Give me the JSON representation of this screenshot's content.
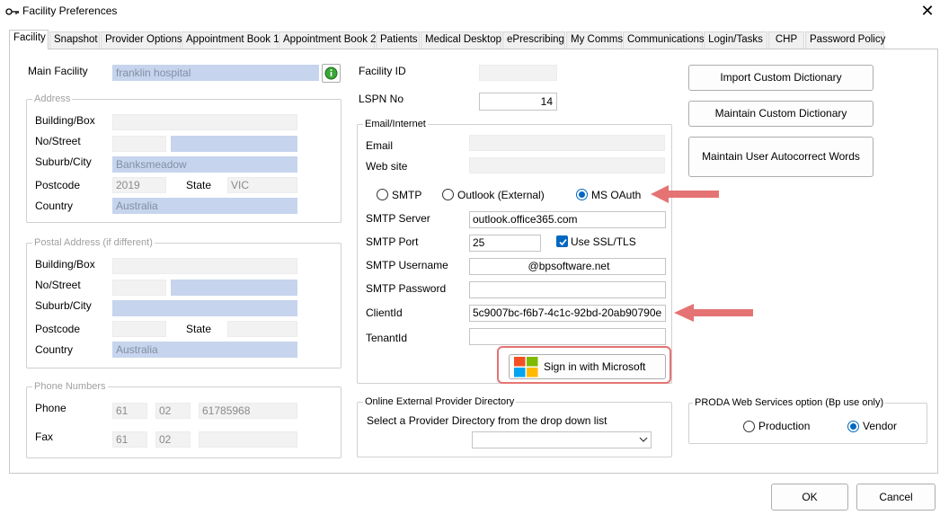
{
  "window": {
    "title": "Facility Preferences"
  },
  "tabs": [
    {
      "label": "Facility",
      "active": true
    },
    {
      "label": "Snapshot"
    },
    {
      "label": "Provider Options"
    },
    {
      "label": "Appointment Book 1"
    },
    {
      "label": "Appointment Book 2"
    },
    {
      "label": "Patients"
    },
    {
      "label": "Medical Desktop"
    },
    {
      "label": "ePrescribing"
    },
    {
      "label": "My Comms"
    },
    {
      "label": "Communications"
    },
    {
      "label": "Login/Tasks"
    },
    {
      "label": "CHP"
    },
    {
      "label": "Password Policy"
    }
  ],
  "facility": {
    "main_facility_label": "Main Facility",
    "main_facility_value": "franklin hospital"
  },
  "address": {
    "legend": "Address",
    "building_label": "Building/Box",
    "street_label": "No/Street",
    "suburb_label": "Suburb/City",
    "suburb_value": "Banksmeadow",
    "postcode_label": "Postcode",
    "postcode_value": "2019",
    "state_label": "State",
    "state_value": "VIC",
    "country_label": "Country",
    "country_value": "Australia"
  },
  "postal": {
    "legend": "Postal Address (if different)",
    "building_label": "Building/Box",
    "street_label": "No/Street",
    "suburb_label": "Suburb/City",
    "postcode_label": "Postcode",
    "state_label": "State",
    "country_label": "Country",
    "country_value": "Australia"
  },
  "phones": {
    "legend": "Phone Numbers",
    "phone_label": "Phone",
    "phone_country": "61",
    "phone_area": "02",
    "phone_number": "61785968",
    "fax_label": "Fax",
    "fax_country": "61",
    "fax_area": "02"
  },
  "ids": {
    "facility_id_label": "Facility ID",
    "lspn_label": "LSPN No",
    "lspn_value": "14"
  },
  "email": {
    "legend": "Email/Internet",
    "email_label": "Email",
    "website_label": "Web site",
    "smtp_option": "SMTP",
    "outlook_option": "Outlook (External)",
    "msoauth_option": "MS OAuth",
    "smtp_server_label": "SMTP Server",
    "smtp_server_value": "outlook.office365.com",
    "smtp_port_label": "SMTP Port",
    "smtp_port_value": "25",
    "ssl_label": "Use SSL/TLS",
    "smtp_username_label": "SMTP Username",
    "smtp_username_value": "@bpsoftware.net",
    "smtp_password_label": "SMTP Password",
    "client_id_label": "ClientId",
    "client_id_value": "5c9007bc-f6b7-4c1c-92bd-20ab90790e",
    "tenant_id_label": "TenantId",
    "sign_in_label": "Sign in with Microsoft"
  },
  "provider_directory": {
    "legend": "Online External Provider Directory",
    "instruction": "Select a Provider Directory from the drop down list"
  },
  "dictionary_buttons": {
    "import": "Import Custom Dictionary",
    "maintain": "Maintain Custom Dictionary",
    "autocorrect": "Maintain User Autocorrect Words"
  },
  "proda": {
    "legend": "PRODA Web Services option (Bp  use only)",
    "production_option": "Production",
    "vendor_option": "Vendor"
  },
  "footer": {
    "ok": "OK",
    "cancel": "Cancel"
  },
  "colors": {
    "highlight_arrow": "#e57373",
    "accent": "#0067c0",
    "field_blue": "#c7d4ed"
  }
}
